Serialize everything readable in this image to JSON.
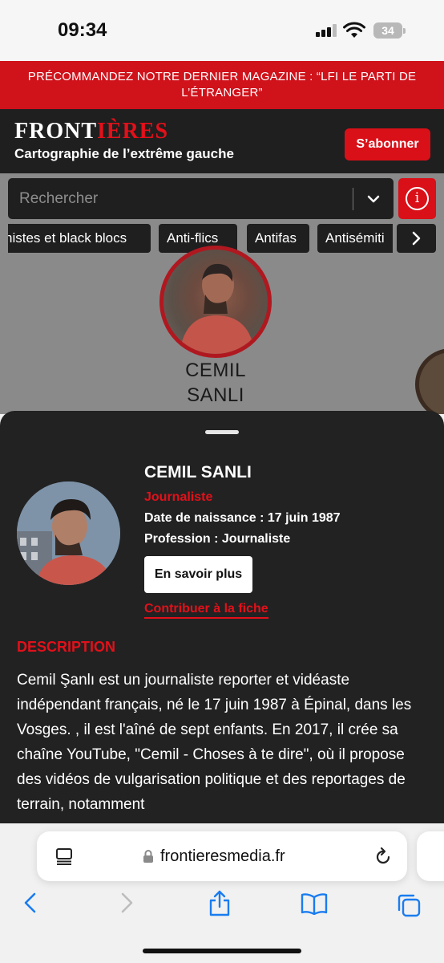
{
  "status_bar": {
    "time": "09:34",
    "battery": "34"
  },
  "promo": {
    "text": "PRÉCOMMANDEZ NOTRE DERNIER MAGAZINE : “LFI LE PARTI DE L’ÉTRANGER”"
  },
  "header": {
    "logo_main": "FRONT",
    "logo_accent": "IÈRES",
    "tagline": "Cartographie de l’extrême gauche",
    "subscribe_label": "S’abonner"
  },
  "search": {
    "placeholder": "Rechercher"
  },
  "categories": [
    "nistes et black blocs",
    "Anti-flics",
    "Antifas",
    "Antisémiti"
  ],
  "background_card": {
    "name_line1": "CEMIL",
    "name_line2": "SANLI"
  },
  "profile": {
    "name": "CEMIL SANLI",
    "role": "Journaliste",
    "dob": "Date de naissance : 17 juin 1987",
    "profession": "Profession : Journaliste",
    "more_label": "En savoir plus",
    "contribute_label": "Contribuer à la fiche",
    "description_heading": "DESCRIPTION",
    "description": "Cemil Şanlı est un journaliste reporter et vidéaste indépendant français, né le 17 juin 1987 à Épinal, dans les Vosges. , il est l'aîné de sept enfants. En 2017, il crée sa chaîne YouTube, \"Cemil - Choses à te dire\", où il propose des vidéos de vulgarisation politique et des reportages de terrain, notamment"
  },
  "browser": {
    "url": "frontieresmedia.fr"
  },
  "colors": {
    "accent": "#d91018",
    "dark": "#222222",
    "promo": "#d0121b"
  }
}
